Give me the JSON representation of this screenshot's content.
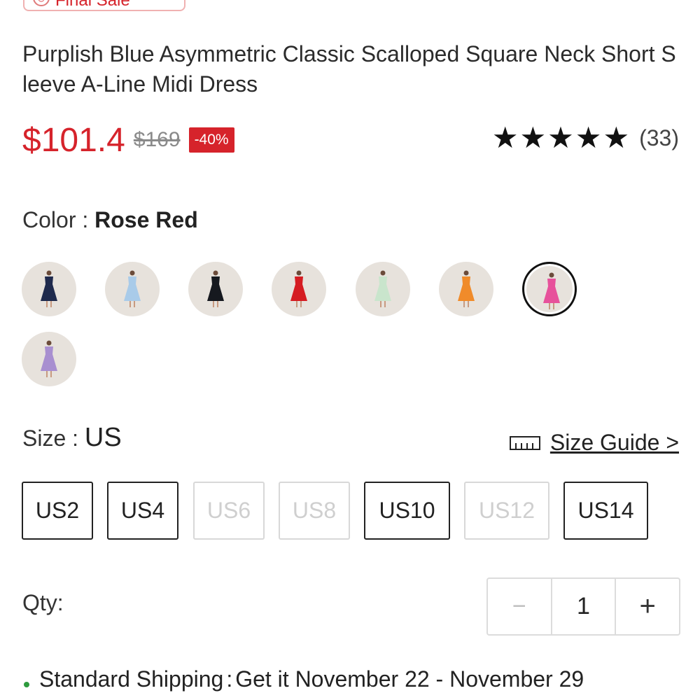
{
  "badge": {
    "label": "Final Sale",
    "icon": "clock-icon"
  },
  "product": {
    "title": "Purplish Blue Asymmetric Classic Scalloped Square Neck Short Sleeve A-Line Midi Dress",
    "price": "$101.4",
    "original_price": "$169",
    "discount": "-40%",
    "stars": "★★★★★",
    "rating": 5,
    "review_count": "(33)"
  },
  "color": {
    "label": "Color : ",
    "selected": "Rose Red",
    "swatches": [
      {
        "name": "navy",
        "hex": "#1f2a4d",
        "selected": false
      },
      {
        "name": "light blue",
        "hex": "#a9cbe9",
        "selected": false
      },
      {
        "name": "black",
        "hex": "#16191f",
        "selected": false
      },
      {
        "name": "red",
        "hex": "#d51c22",
        "selected": false
      },
      {
        "name": "mint",
        "hex": "#c9e5cc",
        "selected": false
      },
      {
        "name": "orange",
        "hex": "#f08b2a",
        "selected": false
      },
      {
        "name": "rose red",
        "hex": "#e7519b",
        "selected": true
      },
      {
        "name": "lavender",
        "hex": "#a88fd0",
        "selected": false
      }
    ]
  },
  "size": {
    "label": "Size : ",
    "system": "US",
    "guide_label": "Size Guide >",
    "options": [
      {
        "label": "US2",
        "available": true
      },
      {
        "label": "US4",
        "available": true
      },
      {
        "label": "US6",
        "available": false
      },
      {
        "label": "US8",
        "available": false
      },
      {
        "label": "US10",
        "available": true
      },
      {
        "label": "US12",
        "available": false
      },
      {
        "label": "US14",
        "available": true
      }
    ]
  },
  "quantity": {
    "label": "Qty:",
    "value": "1",
    "minus": "−",
    "plus": "+"
  },
  "shipping": {
    "method": "Standard Shipping",
    "separator": ":",
    "estimate": "Get it November 22 - November 29"
  },
  "colors": {
    "accent": "#d6232b",
    "shipping_dot": "#2e9b3e"
  }
}
